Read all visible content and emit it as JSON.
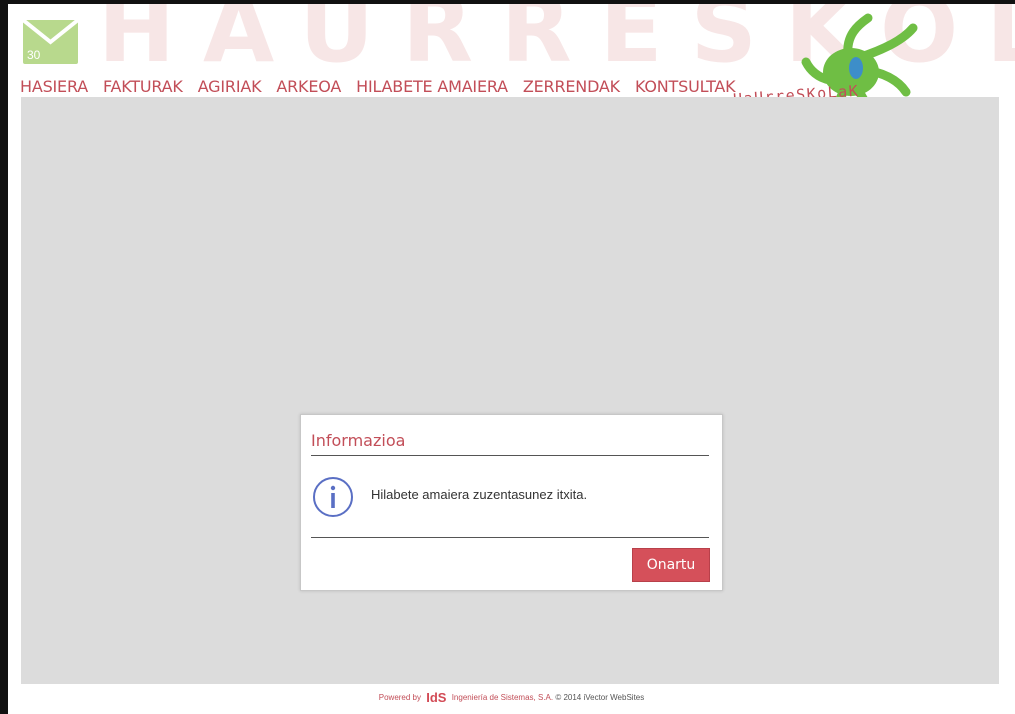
{
  "brand": {
    "watermark": "HAURRESKOLAK",
    "logo_text": "HaUrreSKoLaK",
    "colors": {
      "accent": "#c24e58",
      "mail": "#b8d98d",
      "logo_green": "#6fbe44",
      "content_bg": "#dcdcdc"
    }
  },
  "mail": {
    "icon": "envelope-icon",
    "count": "30"
  },
  "nav": {
    "items": [
      {
        "label": "HASIERA"
      },
      {
        "label": "FAKTURAK"
      },
      {
        "label": "AGIRIAK"
      },
      {
        "label": "ARKEOA"
      },
      {
        "label": "HILABETE AMAIERA"
      },
      {
        "label": "ZERRENDAK"
      },
      {
        "label": "KONTSULTAK"
      }
    ]
  },
  "dialog": {
    "title": "Informazioa",
    "icon": "info-icon",
    "message": "Hilabete amaiera zuzentasunez itxita.",
    "ok_label": "Onartu"
  },
  "footer": {
    "powered": "Powered by",
    "logo": "IdS",
    "company": "Ingeniería de Sistemas, S.A.",
    "copyright": "© 2014 iVector WebSites"
  }
}
